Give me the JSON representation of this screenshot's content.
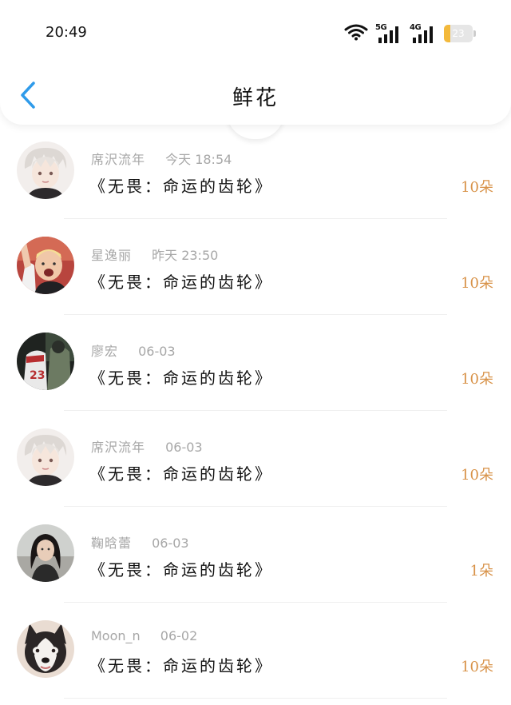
{
  "status_bar": {
    "time": "20:49",
    "network_1": "5G",
    "network_2": "4G",
    "battery_level": "23",
    "battery_percent": 0.23
  },
  "header": {
    "title": "鲜花",
    "back_icon": "chevron-left-icon"
  },
  "colors": {
    "accent": "#2f9bea",
    "count": "#d89248",
    "meta": "#a7a7a7",
    "battery": "#f3b93b"
  },
  "gifts": [
    {
      "name": "席沢流年",
      "time": "今天 18:54",
      "book": "《无畏：命运的齿轮》",
      "count": "10朵",
      "avatar": "anime-boy-avatar"
    },
    {
      "name": "星逸丽",
      "time": "昨天 23:50",
      "book": "《无畏：命运的齿轮》",
      "count": "10朵",
      "avatar": "child-photo-avatar"
    },
    {
      "name": "廖宏",
      "time": "06-03",
      "book": "《无畏：命运的齿轮》",
      "count": "10朵",
      "avatar": "jersey-photo-avatar"
    },
    {
      "name": "席沢流年",
      "time": "06-03",
      "book": "《无畏：命运的齿轮》",
      "count": "10朵",
      "avatar": "anime-boy-avatar"
    },
    {
      "name": "鞠晗蕾",
      "time": "06-03",
      "book": "《无畏：命运的齿轮》",
      "count": "1朵",
      "avatar": "woman-photo-avatar"
    },
    {
      "name": "Moon_n",
      "time": "06-02",
      "book": "《无畏：命运的齿轮》",
      "count": "10朵",
      "avatar": "husky-dog-avatar"
    }
  ]
}
